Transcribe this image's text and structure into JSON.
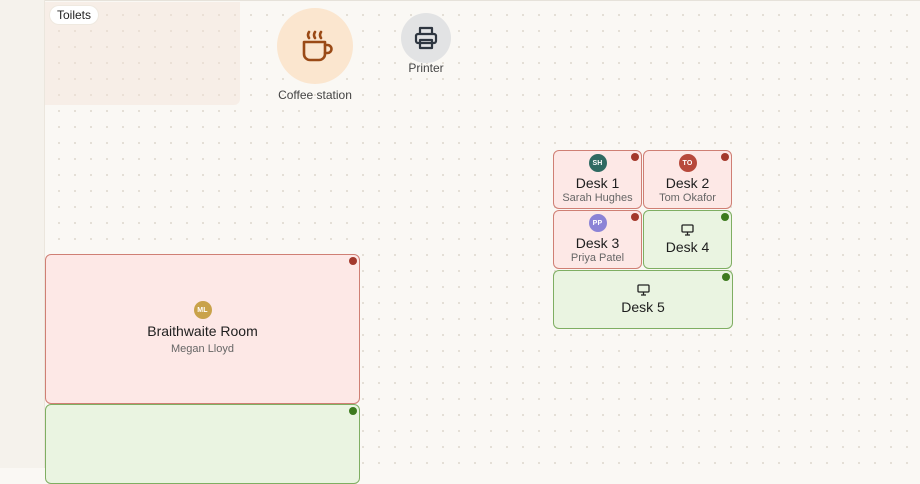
{
  "zones": {
    "toilets_label": "Toilets"
  },
  "amenities": {
    "coffee_label": "Coffee station",
    "printer_label": "Printer"
  },
  "rooms": {
    "braithwaite": {
      "name": "Braithwaite Room",
      "occupant": "Megan Lloyd",
      "initials": "ML",
      "status": "occupied"
    },
    "room_below": {
      "status": "available"
    }
  },
  "desks": [
    {
      "name": "Desk 1",
      "occupant": "Sarah Hughes",
      "initials": "SH",
      "status": "occupied"
    },
    {
      "name": "Desk 2",
      "occupant": "Tom Okafor",
      "initials": "TO",
      "status": "occupied"
    },
    {
      "name": "Desk 3",
      "occupant": "Priya Patel",
      "initials": "PP",
      "status": "occupied"
    },
    {
      "name": "Desk 4",
      "status": "available",
      "icon": "monitor-icon"
    },
    {
      "name": "Desk 5",
      "status": "available",
      "icon": "monitor-icon"
    }
  ],
  "colors": {
    "occupied_fill": "#fde8e6",
    "occupied_dot": "#a3392c",
    "available_fill": "#eaf4e1",
    "available_dot": "#3d7a1e",
    "avatar_sh": "#2f6a62",
    "avatar_to": "#b7493c",
    "avatar_pp": "#8b83d6",
    "avatar_ml": "#c9a24a"
  }
}
